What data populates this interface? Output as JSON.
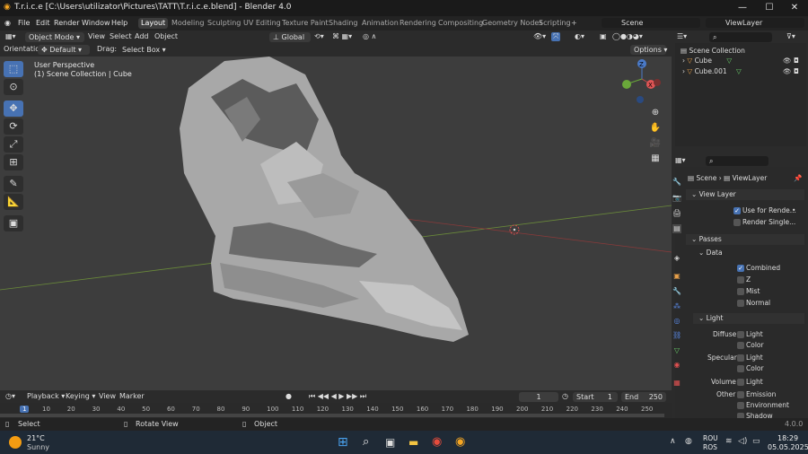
{
  "window": {
    "title": "T.r.i.c.e [C:\\Users\\utilizator\\Pictures\\TATT\\T.r.i.c.e.blend] - Blender 4.0",
    "min": "—",
    "max": "☐",
    "close": "✕"
  },
  "menu": [
    "File",
    "Edit",
    "Render",
    "Window",
    "Help"
  ],
  "workspaces": [
    "Layout",
    "Modeling",
    "Sculpting",
    "UV Editing",
    "Texture Paint",
    "Shading",
    "Animation",
    "Rendering",
    "Compositing",
    "Geometry Nodes",
    "Scripting"
  ],
  "scene": "Scene",
  "view_layer": "ViewLayer",
  "viewport_header": {
    "mode": "Object Mode",
    "menus": [
      "View",
      "Select",
      "Add",
      "Object"
    ],
    "transform": "Global",
    "options": "Options"
  },
  "orientation": {
    "label": "Orientation:",
    "value": "Default",
    "drag_label": "Drag:",
    "drag_value": "Select Box"
  },
  "viewport": {
    "line1": "User Perspective",
    "line2": "(1) Scene Collection | Cube"
  },
  "outliner": {
    "root": "Scene Collection",
    "items": [
      "Cube",
      "Cube.001"
    ]
  },
  "properties": {
    "breadcrumb_scene": "Scene",
    "breadcrumb_layer": "ViewLayer",
    "view_layer_panel": "View Layer",
    "use_for_render": "Use for Rende...",
    "render_single": "Render Single...",
    "passes_panel": "Passes",
    "data_panel": "Data",
    "data_items": [
      "Combined",
      "Z",
      "Mist",
      "Normal"
    ],
    "light_panel": "Light",
    "diffuse": "Diffuse",
    "specular": "Specular",
    "volume": "Volume",
    "other": "Other",
    "light": "Light",
    "color": "Color",
    "other_items": [
      "Emission",
      "Environment",
      "Shadow"
    ]
  },
  "timeline": {
    "menus": [
      "Playback",
      "Keying",
      "View",
      "Marker"
    ],
    "current": "1",
    "start_label": "Start",
    "start": "1",
    "end_label": "End",
    "end": "250",
    "ticks": [
      "1",
      "10",
      "20",
      "30",
      "40",
      "50",
      "60",
      "70",
      "80",
      "90",
      "100",
      "110",
      "120",
      "130",
      "140",
      "150",
      "160",
      "170",
      "180",
      "190",
      "200",
      "210",
      "220",
      "230",
      "240",
      "250"
    ]
  },
  "status": {
    "select": "Select",
    "rotate": "Rotate View",
    "object": "Object",
    "version": "4.0.0"
  },
  "taskbar": {
    "temp": "21°C",
    "weather": "Sunny",
    "lang1": "ROU",
    "lang2": "ROS",
    "time": "18:29",
    "date": "05.05.2025"
  }
}
